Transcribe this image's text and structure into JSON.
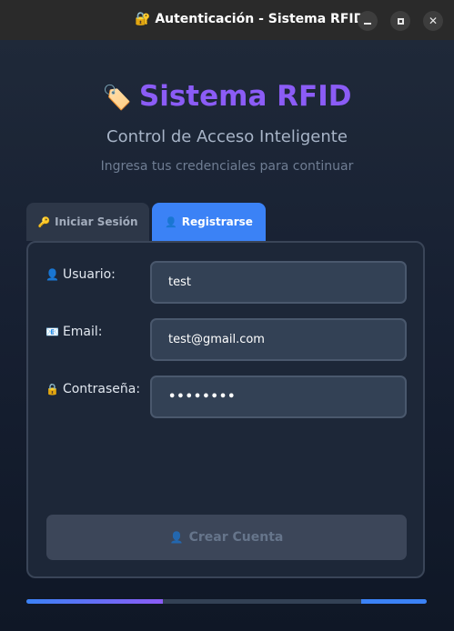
{
  "window": {
    "title_icon": "🔐",
    "title": "Autenticación - Sistema RFID",
    "controls": [
      "minimize-icon",
      "maximize-icon",
      "close-icon"
    ]
  },
  "header": {
    "logo_icon": "🏷️",
    "title": "Sistema RFID",
    "subtitle": "Control de Acceso Inteligente",
    "instruction": "Ingresa tus credenciales para continuar"
  },
  "tabs": [
    {
      "icon": "🔑",
      "label": "Iniciar Sesión",
      "active": false
    },
    {
      "icon": "👤",
      "label": "Registrarse",
      "active": true
    }
  ],
  "form": {
    "username": {
      "icon": "👤",
      "label": "Usuario:",
      "value": "test"
    },
    "email": {
      "icon": "📧",
      "label": "Email:",
      "value": "test@gmail.com"
    },
    "password": {
      "icon": "🔒",
      "label": "Contraseña:",
      "value": "••••••••"
    },
    "submit": {
      "icon": "👤",
      "label": "Crear Cuenta",
      "enabled": false
    }
  },
  "progress": {
    "fraction": 0.34
  },
  "colors": {
    "accent": "#3b82f6",
    "brand": "#8b5cf6",
    "background": "#172032"
  }
}
